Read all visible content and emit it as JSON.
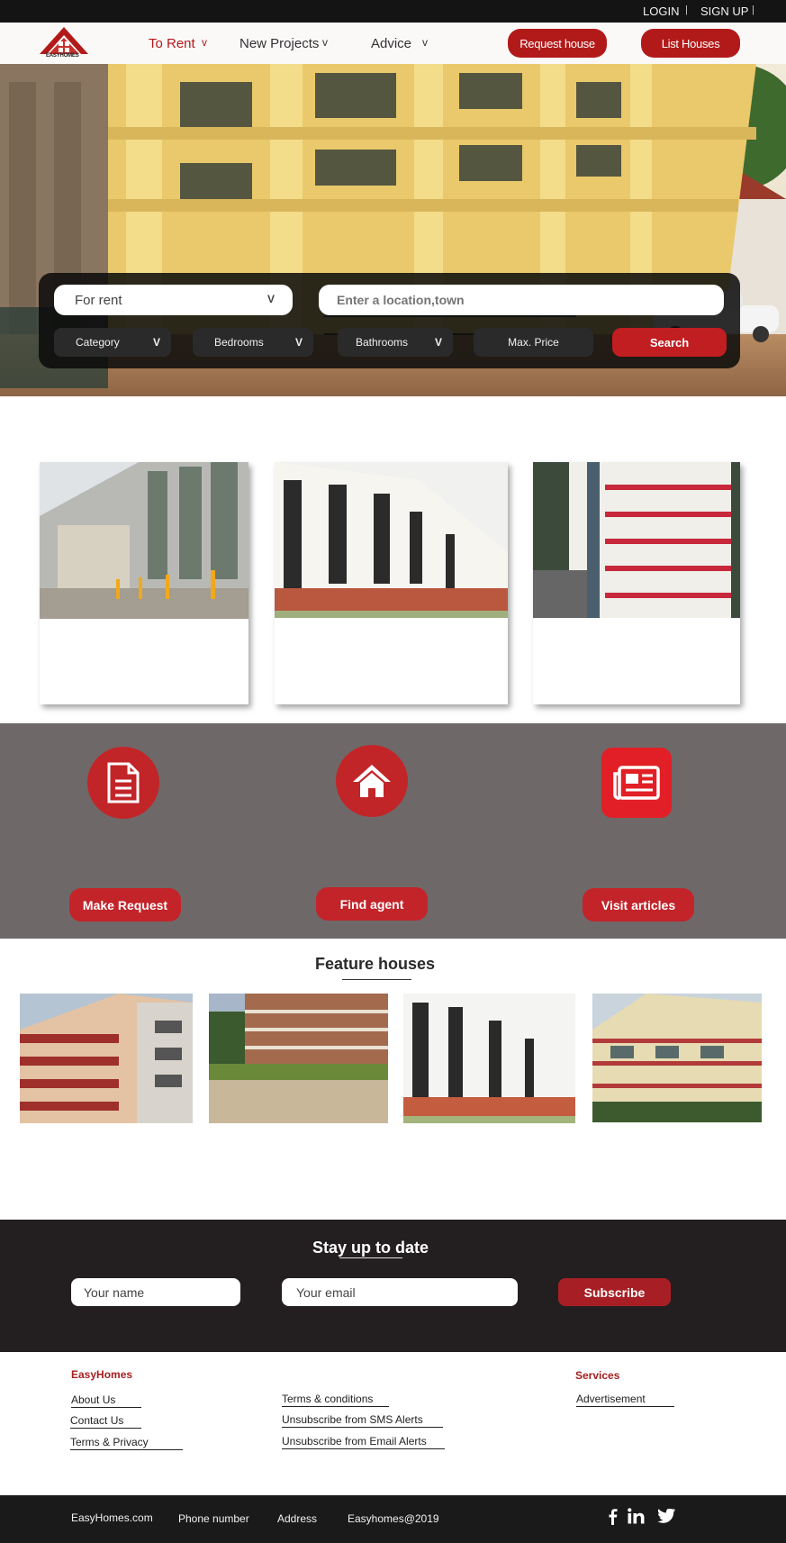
{
  "topbar": {
    "login": "LOGIN",
    "signup": "SIGN UP",
    "separator": "|"
  },
  "nav": {
    "logo_text": "EASYHOMES",
    "items": [
      {
        "label": "To Rent",
        "chevron": "v"
      },
      {
        "label": "New Projects",
        "chevron": "v"
      },
      {
        "label": "Advice",
        "chevron": "v"
      }
    ],
    "request_button": "Request house",
    "list_button": "List Houses"
  },
  "search": {
    "mode_value": "For rent",
    "mode_chevron": "V",
    "location_placeholder": "Enter a location,town",
    "category": "Category",
    "bedrooms": "Bedrooms",
    "bathrooms": "Bathrooms",
    "max_price": "Max. Price",
    "chevron": "V",
    "search_button": "Search"
  },
  "services": {
    "make_request": "Make Request",
    "find_agent": "Find agent",
    "visit_articles": "Visit articles",
    "icons": [
      "document-icon",
      "home-icon",
      "newspaper-icon"
    ]
  },
  "feature": {
    "title": "Feature houses"
  },
  "newsletter": {
    "title": "Stay up to date",
    "name_placeholder": "Your name",
    "email_placeholder": "Your email",
    "subscribe_button": "Subscribe"
  },
  "footer": {
    "brand_heading": "EasyHomes",
    "brand_links": [
      "About Us",
      "Contact Us",
      "Terms & Privacy"
    ],
    "middle_links": [
      "Terms & conditions",
      "Unsubscribe from SMS Alerts",
      "Unsubscribe from Email Alerts"
    ],
    "services_heading": "Services",
    "services_links": [
      "Advertisement"
    ]
  },
  "bottom": {
    "site": "EasyHomes.com",
    "phone": "Phone number",
    "address": "Address",
    "copyright": "Easyhomes@2019",
    "social_icons": [
      "facebook-icon",
      "linkedin-icon",
      "twitter-icon"
    ]
  },
  "colors": {
    "brand_red": "#b21a1a",
    "band_gray": "#6f6869",
    "dark": "#231f20"
  }
}
